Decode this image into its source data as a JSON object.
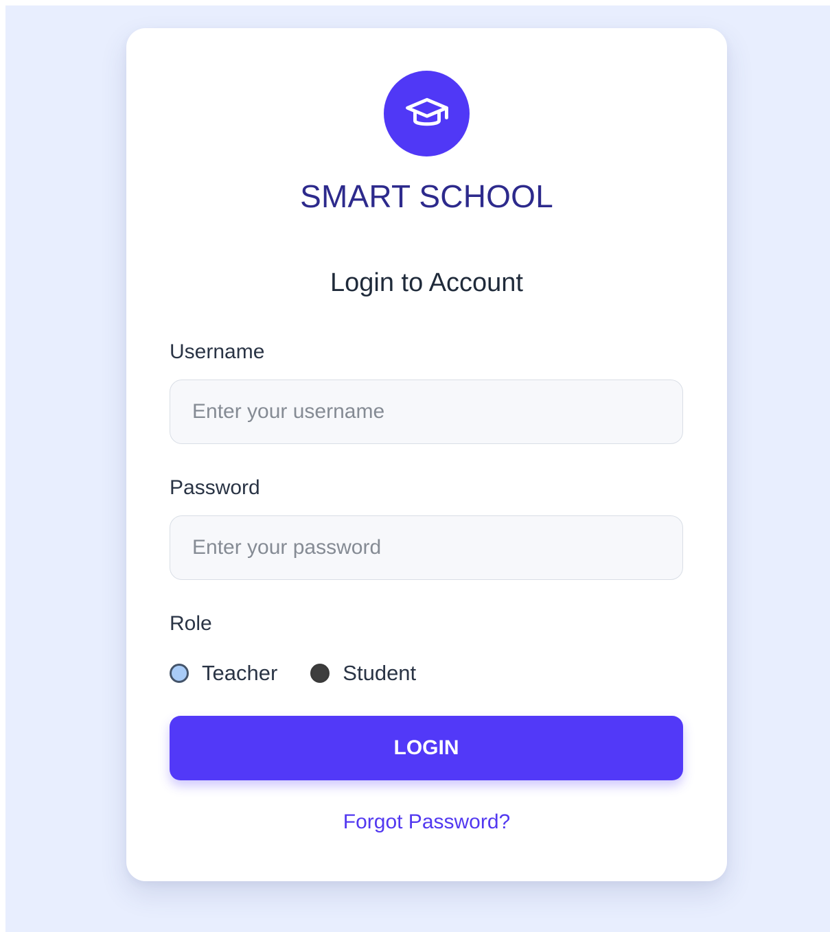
{
  "brand": {
    "name": "SMART SCHOOL",
    "logo_icon": "graduation-cap-icon",
    "accent_color": "#5038f6"
  },
  "form": {
    "title": "Login to Account",
    "username": {
      "label": "Username",
      "placeholder": "Enter your username",
      "value": ""
    },
    "password": {
      "label": "Password",
      "placeholder": "Enter your password",
      "value": ""
    },
    "role": {
      "label": "Role",
      "options": [
        {
          "label": "Teacher"
        },
        {
          "label": "Student"
        }
      ]
    },
    "submit_label": "LOGIN",
    "forgot_label": "Forgot Password?"
  }
}
